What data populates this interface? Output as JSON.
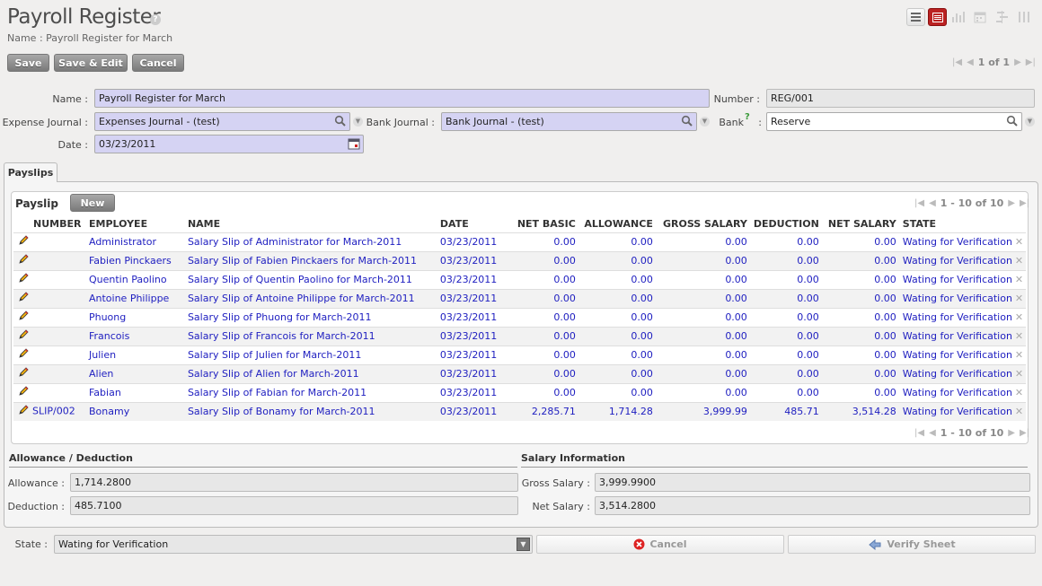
{
  "header": {
    "title": "Payroll Register",
    "help": "?",
    "subtitle": "Name : Payroll Register for March"
  },
  "view_modes": [
    "list-icon",
    "form-icon",
    "graph-icon",
    "calendar-icon",
    "gantt-icon",
    "kanban-icon"
  ],
  "toolbar": {
    "save": "Save",
    "save_edit": "Save & Edit",
    "cancel": "Cancel",
    "pager": "1 of 1"
  },
  "form": {
    "name_label": "Name :",
    "name_value": "Payroll Register for March",
    "number_label": "Number :",
    "number_value": "REG/001",
    "expense_label": "Expense Journal :",
    "expense_value": "Expenses Journal - (test)",
    "bank_journal_label": "Bank Journal :",
    "bank_journal_value": "Bank Journal - (test)",
    "bank_label": "Bank",
    "bank_help": "?",
    "bank_colon": ":",
    "bank_value": "Reserve",
    "date_label": "Date :",
    "date_value": "03/23/2011"
  },
  "tab": "Payslips",
  "payslip": {
    "title": "Payslip",
    "new": "New",
    "pager": "1 - 10 of 10",
    "columns": [
      "NUMBER",
      "EMPLOYEE",
      "NAME",
      "DATE",
      "NET BASIC",
      "ALLOWANCE",
      "GROSS SALARY",
      "DEDUCTION",
      "NET SALARY",
      "STATE"
    ],
    "rows": [
      [
        "",
        "Administrator",
        "Salary Slip of Administrator for March-2011",
        "03/23/2011",
        "0.00",
        "0.00",
        "0.00",
        "0.00",
        "0.00",
        "Wating for Verification"
      ],
      [
        "",
        "Fabien Pinckaers",
        "Salary Slip of Fabien Pinckaers for March-2011",
        "03/23/2011",
        "0.00",
        "0.00",
        "0.00",
        "0.00",
        "0.00",
        "Wating for Verification"
      ],
      [
        "",
        "Quentin Paolino",
        "Salary Slip of Quentin Paolino for March-2011",
        "03/23/2011",
        "0.00",
        "0.00",
        "0.00",
        "0.00",
        "0.00",
        "Wating for Verification"
      ],
      [
        "",
        "Antoine Philippe",
        "Salary Slip of Antoine Philippe for March-2011",
        "03/23/2011",
        "0.00",
        "0.00",
        "0.00",
        "0.00",
        "0.00",
        "Wating for Verification"
      ],
      [
        "",
        "Phuong",
        "Salary Slip of Phuong for March-2011",
        "03/23/2011",
        "0.00",
        "0.00",
        "0.00",
        "0.00",
        "0.00",
        "Wating for Verification"
      ],
      [
        "",
        "Francois",
        "Salary Slip of Francois for March-2011",
        "03/23/2011",
        "0.00",
        "0.00",
        "0.00",
        "0.00",
        "0.00",
        "Wating for Verification"
      ],
      [
        "",
        "Julien",
        "Salary Slip of Julien for March-2011",
        "03/23/2011",
        "0.00",
        "0.00",
        "0.00",
        "0.00",
        "0.00",
        "Wating for Verification"
      ],
      [
        "",
        "Alien",
        "Salary Slip of Alien for March-2011",
        "03/23/2011",
        "0.00",
        "0.00",
        "0.00",
        "0.00",
        "0.00",
        "Wating for Verification"
      ],
      [
        "",
        "Fabian",
        "Salary Slip of Fabian for March-2011",
        "03/23/2011",
        "0.00",
        "0.00",
        "0.00",
        "0.00",
        "0.00",
        "Wating for Verification"
      ],
      [
        "SLIP/002",
        "Bonamy",
        "Salary Slip of Bonamy for March-2011",
        "03/23/2011",
        "2,285.71",
        "1,714.28",
        "3,999.99",
        "485.71",
        "3,514.28",
        "Wating for Verification"
      ]
    ]
  },
  "allowance_section": {
    "title": "Allowance / Deduction",
    "allowance_label": "Allowance :",
    "allowance_value": "1,714.2800",
    "deduction_label": "Deduction :",
    "deduction_value": "485.7100"
  },
  "salary_section": {
    "title": "Salary Information",
    "gross_label": "Gross Salary :",
    "gross_value": "3,999.9900",
    "net_label": "Net Salary :",
    "net_value": "3,514.2800"
  },
  "footer": {
    "state_label": "State :",
    "state_value": "Wating for Verification",
    "cancel": "Cancel",
    "verify": "Verify Sheet"
  }
}
